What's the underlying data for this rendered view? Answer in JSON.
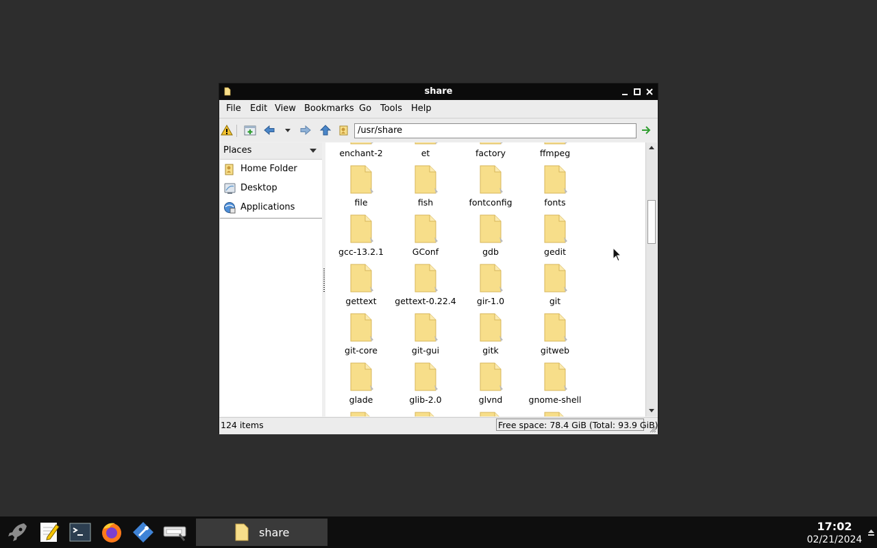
{
  "window": {
    "title": "share",
    "menu": [
      "File",
      "Edit",
      "View",
      "Bookmarks",
      "Go",
      "Tools",
      "Help"
    ],
    "location": "/usr/share"
  },
  "sidebar": {
    "header": "Places",
    "items": [
      {
        "label": "Home Folder",
        "icon": "home-folder-icon"
      },
      {
        "label": "Desktop",
        "icon": "desktop-icon"
      },
      {
        "label": "Applications",
        "icon": "applications-icon"
      }
    ]
  },
  "files": [
    "enchant-2",
    "et",
    "factory",
    "ffmpeg",
    "file",
    "fish",
    "fontconfig",
    "fonts",
    "gcc-13.2.1",
    "GConf",
    "gdb",
    "gedit",
    "gettext",
    "gettext-0.22.4",
    "gir-1.0",
    "git",
    "git-core",
    "git-gui",
    "gitk",
    "gitweb",
    "glade",
    "glib-2.0",
    "glvnd",
    "gnome-shell"
  ],
  "status": {
    "items": "124 items",
    "free_space": "Free space: 78.4 GiB (Total: 93.9 GiB)"
  },
  "taskbar": {
    "launchers": [
      "rocket-launcher-icon",
      "text-editor-icon",
      "terminal-icon",
      "firefox-icon",
      "pinned-app-icon",
      "screenshot-tool-icon"
    ],
    "task_label": "share",
    "time": "17:02",
    "date": "02/21/2024"
  },
  "colors": {
    "titlebar": "#0b0b0b",
    "folder": "#f7de8a",
    "desktop": "#2d2d2d"
  }
}
